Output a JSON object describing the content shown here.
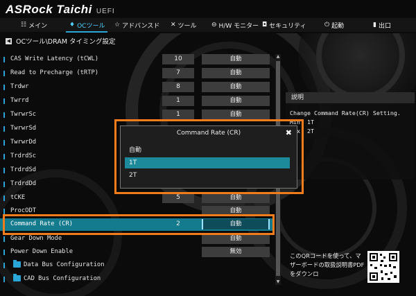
{
  "header": {
    "brand": "ASRock Taichi",
    "firmware": "UEFI"
  },
  "tabs": [
    {
      "label": "メイン"
    },
    {
      "label": "OCツール"
    },
    {
      "label": "アドバンスド"
    },
    {
      "label": "ツール"
    },
    {
      "label": "H/W モニター"
    },
    {
      "label": "セキュリティ"
    },
    {
      "label": "起動"
    },
    {
      "label": "出口"
    }
  ],
  "breadcrumb": "OCツール\\DRAM タイミング設定",
  "rows": [
    {
      "label": "CAS Write Latency (tCWL)",
      "value": "10",
      "option": "自動"
    },
    {
      "label": "Read to Precharge (tRTP)",
      "value": "7",
      "option": "自動"
    },
    {
      "label": "Trdwr",
      "value": "8",
      "option": "自動"
    },
    {
      "label": "Twrrd",
      "value": "1",
      "option": "自動"
    },
    {
      "label": "TwrwrSc",
      "value": "1",
      "option": "自動"
    },
    {
      "label": "TwrwrSd",
      "value": "",
      "option": ""
    },
    {
      "label": "TwrwrDd",
      "value": "",
      "option": ""
    },
    {
      "label": "TrdrdSc",
      "value": "",
      "option": ""
    },
    {
      "label": "TrdrdSd",
      "value": "",
      "option": ""
    },
    {
      "label": "TrdrdDd",
      "value": "",
      "option": ""
    },
    {
      "label": "tCKE",
      "value": "5",
      "option": "自動"
    },
    {
      "label": "ProcODT",
      "value": "",
      "option": "自動"
    },
    {
      "label": "Command Rate (CR)",
      "value": "2",
      "option": "自動"
    },
    {
      "label": "Gear Down Mode",
      "value": "",
      "option": "自動"
    },
    {
      "label": "Power Down Enable",
      "value": "",
      "option": "無効"
    },
    {
      "label": "Data Bus Configuration",
      "value": "",
      "option": ""
    },
    {
      "label": "CAD Bus Configuration",
      "value": "",
      "option": ""
    }
  ],
  "description": {
    "title": "説明",
    "line1": "Change Command Rate(CR) Setting.",
    "line2": "Min: 1T",
    "line3": "Max: 2T"
  },
  "qr_note": "このQRコードを使って、マザーボードの取扱説明書PDFをダウンロ",
  "popup": {
    "title": "Command Rate (CR)",
    "close": "✖",
    "options": [
      "自動",
      "1T",
      "2T"
    ],
    "selected": "1T"
  },
  "colors": {
    "accent": "#2aa7d8",
    "highlight": "#f07c1c",
    "selected_row": "#147a8e"
  }
}
